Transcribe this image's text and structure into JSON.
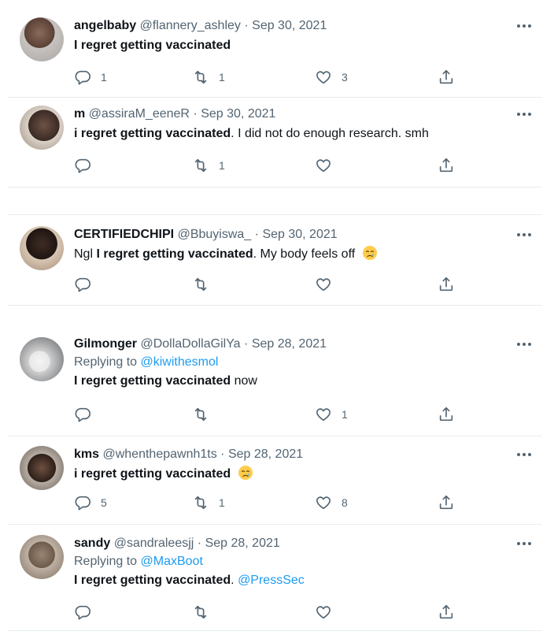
{
  "colors": {
    "text": "#0f1419",
    "secondary": "#536471",
    "link": "#1d9bf0",
    "divider": "#e6ecf0"
  },
  "tweets": [
    {
      "display_name": "angelbaby",
      "handle": "@flannery_ashley",
      "separator": "·",
      "date": "Sep 30, 2021",
      "bold_text": "I regret getting vaccinated",
      "rest_text": "",
      "reply_count": "1",
      "retweet_count": "1",
      "like_count": "3"
    },
    {
      "display_name": "m",
      "handle": "@assiraM_eeneR",
      "separator": "·",
      "date": "Sep 30, 2021",
      "bold_text": "i regret getting vaccinated",
      "rest_text": ". I did not do enough research. smh",
      "reply_count": "",
      "retweet_count": "1",
      "like_count": ""
    },
    {
      "display_name": "CERTIFIEDCHIPI",
      "handle": "@Bbuyiswa_",
      "separator": "·",
      "date": "Sep 30, 2021",
      "pre_text": "Ngl ",
      "bold_text": "I regret getting vaccinated",
      "rest_text": ". My body feels off",
      "emoji": "crying-face-emoji",
      "reply_count": "",
      "retweet_count": "",
      "like_count": ""
    },
    {
      "display_name": "Gilmonger",
      "handle": "@DollaDollaGilYa",
      "separator": "·",
      "date": "Sep 28, 2021",
      "replying_label": "Replying to",
      "replying_to": "@kiwithesmol",
      "bold_text": "I regret getting vaccinated",
      "rest_text": " now",
      "reply_count": "",
      "retweet_count": "",
      "like_count": "1"
    },
    {
      "display_name": "kms",
      "handle": "@whenthepawnh1ts",
      "separator": "·",
      "date": "Sep 28, 2021",
      "bold_text": "i regret getting vaccinated",
      "rest_text": "",
      "emoji": "crying-face-emoji",
      "reply_count": "5",
      "retweet_count": "1",
      "like_count": "8"
    },
    {
      "display_name": "sandy",
      "handle": "@sandraleesjj",
      "separator": "·",
      "date": "Sep 28, 2021",
      "replying_label": "Replying to",
      "replying_to": "@MaxBoot",
      "bold_text": "I regret getting vaccinated",
      "rest_text": ". ",
      "mention": "@PressSec",
      "reply_count": "",
      "retweet_count": "",
      "like_count": ""
    }
  ]
}
